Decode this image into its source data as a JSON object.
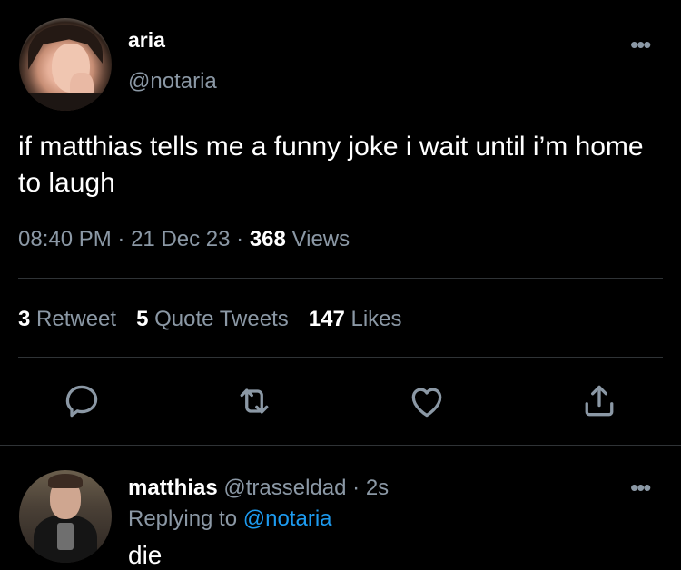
{
  "tweet": {
    "author_name": "aria",
    "author_handle": "@notaria",
    "text": "if matthias tells me a funny joke i wait until i’m home to laugh",
    "time": "08:40 PM",
    "date": "21 Dec 23",
    "views_count": "368",
    "views_label": "Views",
    "sep": "·",
    "retweets_count": "3",
    "retweets_label": "Retweet",
    "quotes_count": "5",
    "quotes_label": "Quote Tweets",
    "likes_count": "147",
    "likes_label": "Likes",
    "more": "•••"
  },
  "reply": {
    "author_name": "matthias",
    "author_handle": "@trasseldad",
    "time": "2s",
    "sep": "·",
    "replying_prefix": "Replying to",
    "replying_to": "@notaria",
    "text": "die",
    "more": "•••"
  },
  "icons": {
    "reply": "reply-icon",
    "retweet": "retweet-icon",
    "like": "heart-icon",
    "share": "share-icon"
  },
  "colors": {
    "background": "#000000",
    "text": "#ffffff",
    "secondary": "#8b98a5",
    "link": "#1d9bf0",
    "divider": "#2f3336"
  }
}
